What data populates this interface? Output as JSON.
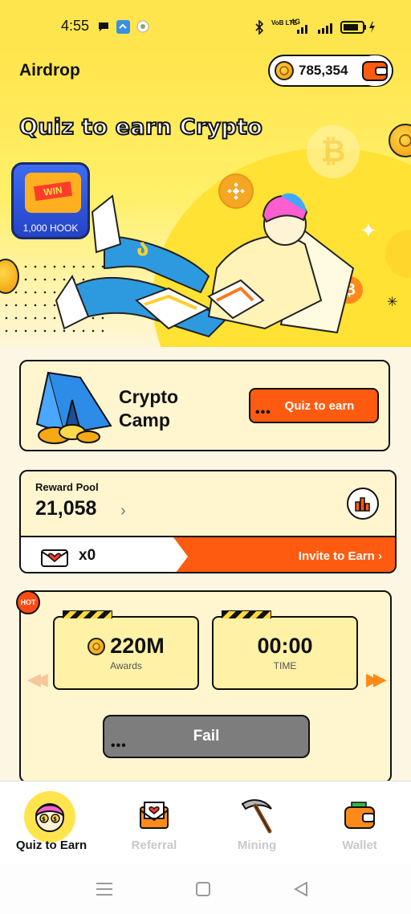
{
  "status_bar": {
    "time": "4:55",
    "network": "4G",
    "volte": "VoB LTE"
  },
  "header": {
    "title": "Airdrop",
    "balance": "785,354"
  },
  "hero": {
    "title": "Quiz to earn Crypto",
    "promo_label": "1,000 HOOK",
    "promo_badge": "WIN"
  },
  "camp": {
    "title_line1": "Crypto",
    "title_line2": "Camp",
    "button_label": "Quiz to earn"
  },
  "reward_pool": {
    "label": "Reward Pool",
    "value": "21,058",
    "ticket_count": "x0",
    "invite_label": "Invite to Earn"
  },
  "game": {
    "hot_label": "HOT",
    "awards_value": "220M",
    "awards_label": "Awards",
    "time_value": "00:00",
    "time_label": "TIME",
    "fail_label": "Fail"
  },
  "bottom_nav": {
    "items": [
      {
        "label": "Quiz to Earn",
        "icon": "avatar-icon",
        "active": true
      },
      {
        "label": "Referral",
        "icon": "envelope-heart-icon",
        "active": false
      },
      {
        "label": "Mining",
        "icon": "pickaxe-icon",
        "active": false
      },
      {
        "label": "Wallet",
        "icon": "wallet-icon",
        "active": false
      }
    ]
  },
  "colors": {
    "accent": "#ff5b10",
    "hero_yellow": "#ffe54d",
    "card_bg": "#fff6cf"
  }
}
